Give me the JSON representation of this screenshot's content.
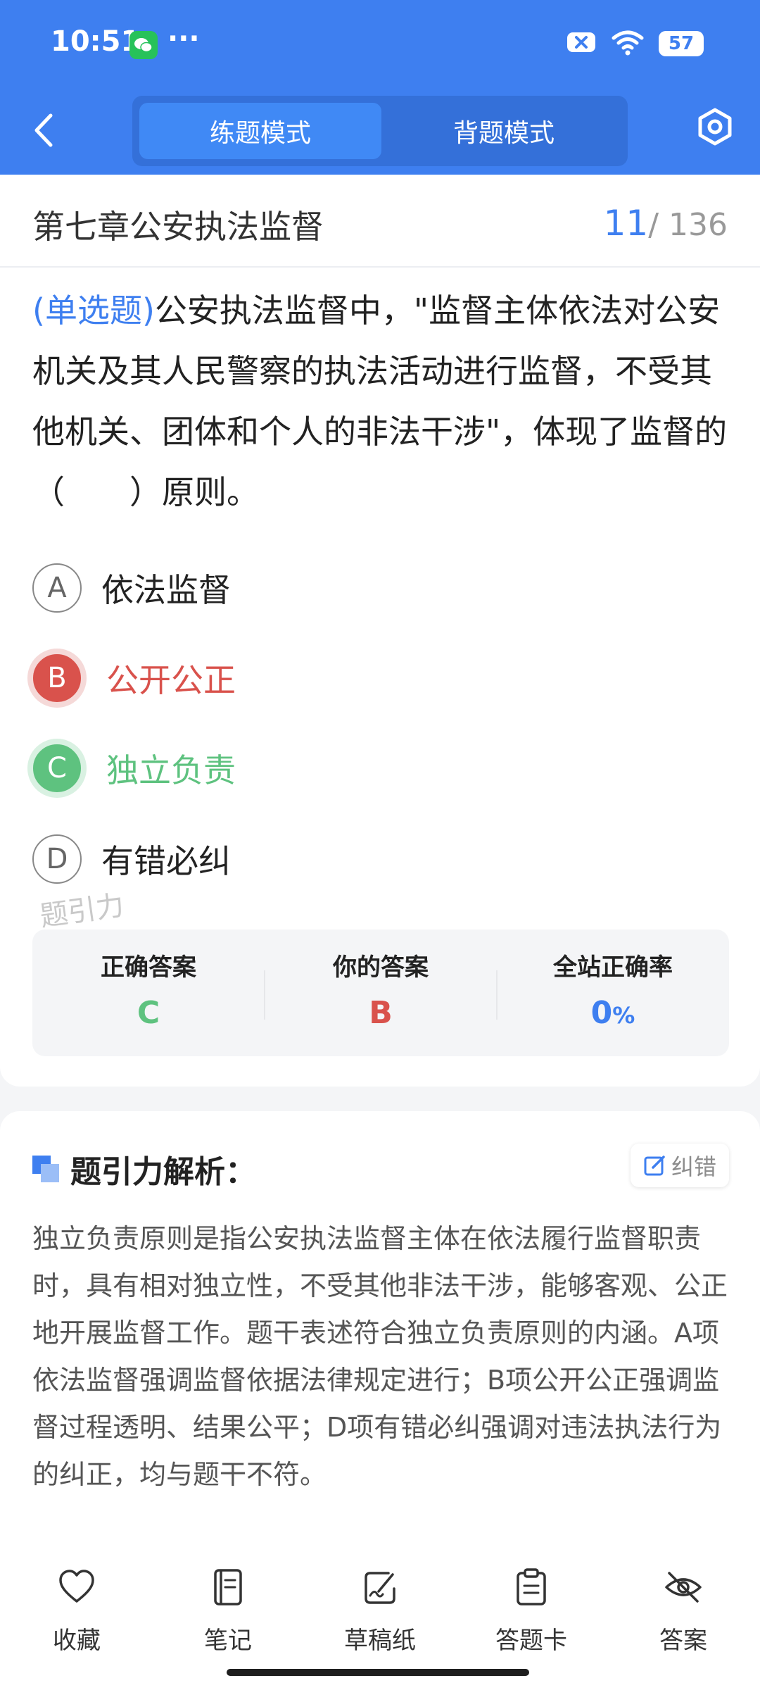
{
  "status_bar": {
    "time": "10:51",
    "dots": "···",
    "battery": "57"
  },
  "header": {
    "tabs": [
      "练题模式",
      "背题模式"
    ],
    "active_tab": "练题模式"
  },
  "chapter": {
    "title": "第七章公安执法监督",
    "current": "11",
    "total": "/ 136"
  },
  "question": {
    "type": "(单选题)",
    "text": "公安执法监督中，\"监督主体依法对公安机关及其人民警察的执法活动进行监督，不受其他机关、团体和个人的非法干涉\"，体现了监督的（　　）原则。"
  },
  "options": [
    {
      "letter": "A",
      "text": "依法监督",
      "state": "normal"
    },
    {
      "letter": "B",
      "text": "公开公正",
      "state": "wrong"
    },
    {
      "letter": "C",
      "text": "独立负责",
      "state": "right"
    },
    {
      "letter": "D",
      "text": "有错必纠",
      "state": "normal"
    }
  ],
  "watermark": "题引力",
  "stats": {
    "correct_label": "正确答案",
    "correct_value": "C",
    "yours_label": "你的答案",
    "yours_value": "B",
    "rate_label": "全站正确率",
    "rate_value": "0",
    "rate_unit": "%"
  },
  "analysis": {
    "title": "题引力解析：",
    "correct_button": "纠错",
    "text": "独立负责原则是指公安执法监督主体在依法履行监督职责时，具有相对独立性，不受其他非法干涉，能够客观、公正地开展监督工作。题干表述符合独立负责原则的内涵。A项依法监督强调监督依据法律规定进行；B项公开公正强调监督过程透明、结果公平；D项有错必纠强调对违法执法行为的纠正，均与题干不符。"
  },
  "bottom_bar": [
    {
      "label": "收藏",
      "icon": "heart-icon"
    },
    {
      "label": "笔记",
      "icon": "notebook-icon"
    },
    {
      "label": "草稿纸",
      "icon": "draft-icon"
    },
    {
      "label": "答题卡",
      "icon": "clipboard-icon"
    },
    {
      "label": "答案",
      "icon": "eye-off-icon"
    }
  ],
  "colors": {
    "primary": "#3e7ff0",
    "wrong": "#d9524c",
    "right": "#5ec27f"
  }
}
